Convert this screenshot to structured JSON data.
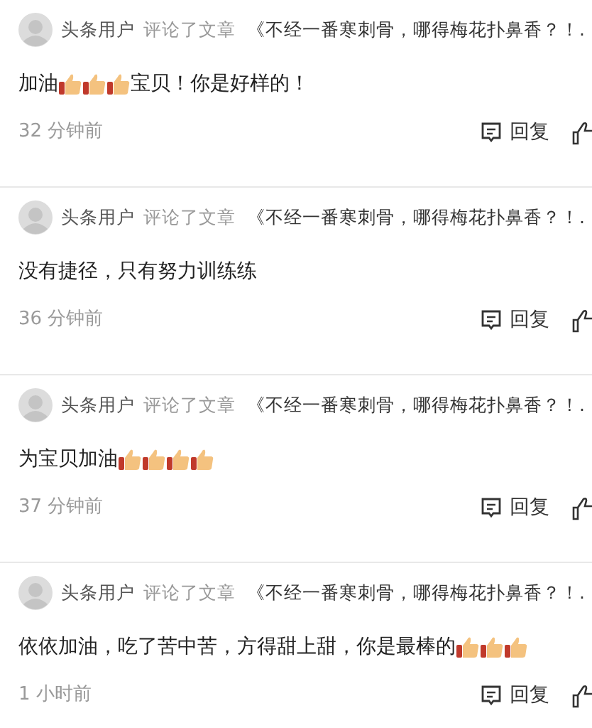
{
  "comments": [
    {
      "user": "头条用户",
      "action": "评论了文章",
      "article": "《不经一番寒刺骨，哪得梅花扑鼻香？！.",
      "content": [
        {
          "kind": "text",
          "text": "加油"
        },
        {
          "kind": "thumbs_up"
        },
        {
          "kind": "thumbs_up"
        },
        {
          "kind": "thumbs_up"
        },
        {
          "kind": "text",
          "text": "宝贝！你是好样的！"
        }
      ],
      "time": "32 分钟前",
      "reply": "回复"
    },
    {
      "user": "头条用户",
      "action": "评论了文章",
      "article": "《不经一番寒刺骨，哪得梅花扑鼻香？！.",
      "content": [
        {
          "kind": "text",
          "text": "没有捷径，只有努力训练练"
        }
      ],
      "time": "36 分钟前",
      "reply": "回复"
    },
    {
      "user": "头条用户",
      "action": "评论了文章",
      "article": "《不经一番寒刺骨，哪得梅花扑鼻香？！.",
      "content": [
        {
          "kind": "text",
          "text": "为宝贝加油"
        },
        {
          "kind": "thumbs_up"
        },
        {
          "kind": "thumbs_up"
        },
        {
          "kind": "thumbs_up"
        },
        {
          "kind": "thumbs_up"
        }
      ],
      "time": "37 分钟前",
      "reply": "回复"
    },
    {
      "user": "头条用户",
      "action": "评论了文章",
      "article": "《不经一番寒刺骨，哪得梅花扑鼻香？！.",
      "content": [
        {
          "kind": "text",
          "text": "依依加油，吃了苦中苦，方得甜上甜，你是最棒的"
        },
        {
          "kind": "thumbs_up"
        },
        {
          "kind": "thumbs_up"
        },
        {
          "kind": "thumbs_up"
        }
      ],
      "time": "1 小时前",
      "reply": "回复"
    }
  ]
}
